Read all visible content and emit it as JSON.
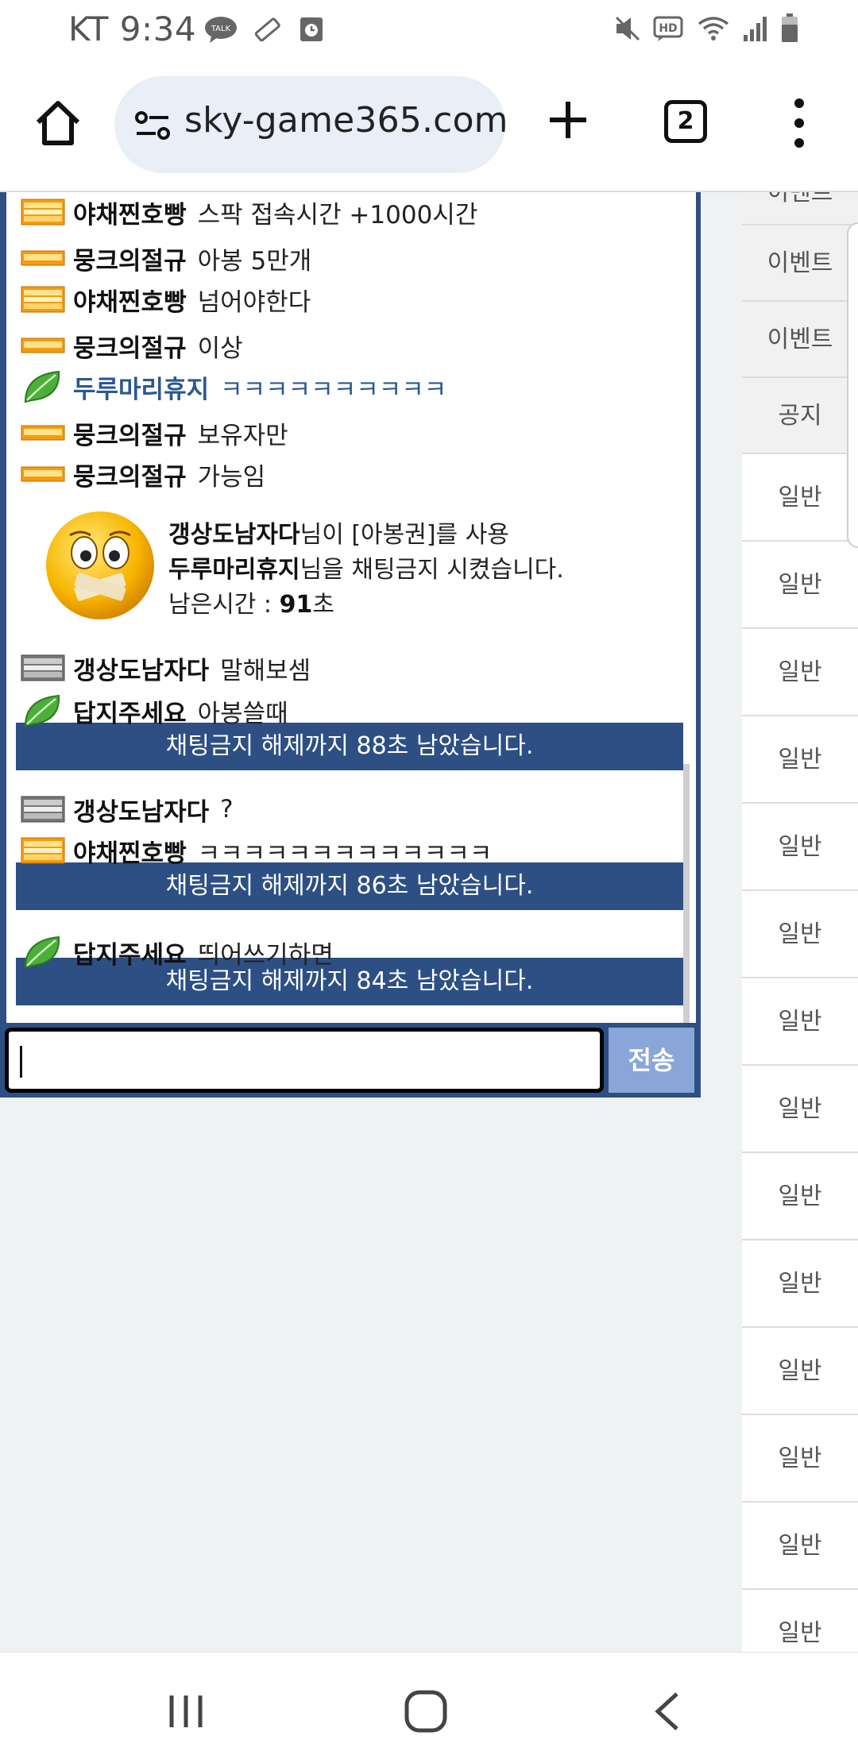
{
  "status_bar": {
    "carrier_time": "KT 9:34",
    "icons": [
      "talk-icon",
      "pen-icon",
      "calendar-icon",
      "mute-icon",
      "hd-icon",
      "wifi-icon",
      "signal-icon",
      "battery-icon"
    ]
  },
  "browser": {
    "url": "sky-game365.com",
    "tab_count": "2"
  },
  "chat": {
    "messages": [
      {
        "badge": "gold",
        "nick": "야채찐호빵",
        "text": "스팍 접속시간 +1000시간"
      },
      {
        "badge": "orange",
        "nick": "뭉크의절규",
        "text": "아봉 5만개"
      },
      {
        "badge": "gold",
        "nick": "야채찐호빵",
        "text": "넘어야한다"
      },
      {
        "badge": "orange",
        "nick": "뭉크의절규",
        "text": "이상"
      },
      {
        "badge": "leaf",
        "nick": "두루마리휴지",
        "text": "ㅋㅋㅋㅋㅋㅋㅋㅋㅋㅋ"
      },
      {
        "badge": "orange",
        "nick": "뭉크의절규",
        "text": "보유자만"
      },
      {
        "badge": "orange",
        "nick": "뭉크의절규",
        "text": "가능임"
      },
      {
        "badge": "silver",
        "nick": "갱상도남자다",
        "text": "말해보셈"
      },
      {
        "badge": "leaf",
        "nick": "답지주세요",
        "text": "아봉쓸때"
      },
      {
        "badge": "silver",
        "nick": "갱상도남자다",
        "text": "?"
      },
      {
        "badge": "gold",
        "nick": "야채찐호빵",
        "text": "ㅋㅋㅋㅋㅋㅋㅋㅋㅋㅋㅋㅋㅋ"
      },
      {
        "badge": "leaf",
        "nick": "답지주세요",
        "text": "띄어쓰기하면"
      }
    ],
    "alert": {
      "line1_bold": "갱상도남자다",
      "line1_rest": "님이 [아봉권]를 사용",
      "line2_bold": "두루마리휴지",
      "line2_rest": "님을 채팅금지 시켰습니다.",
      "line3_label": "남은시간 : ",
      "line3_value": "91",
      "line3_unit": "초"
    },
    "system_notices": [
      "채팅금지 해제까지 88초 남았습니다.",
      "채팅금지 해제까지 86초 남았습니다.",
      "채팅금지 해제까지 84초 남았습니다."
    ],
    "input_value": "",
    "send_label": "전송"
  },
  "categories": [
    "이벤트",
    "이벤트",
    "이벤트",
    "공지",
    "일반",
    "일반",
    "일반",
    "일반",
    "일반",
    "일반",
    "일반",
    "일반",
    "일반",
    "일반",
    "일반",
    "일반",
    "일반",
    "일반"
  ],
  "colors": {
    "chat_border": "#2d4f83",
    "notice_bar": "#2d4f83",
    "send_button": "#8aa6d8",
    "blue_nick": "#2c5890"
  }
}
